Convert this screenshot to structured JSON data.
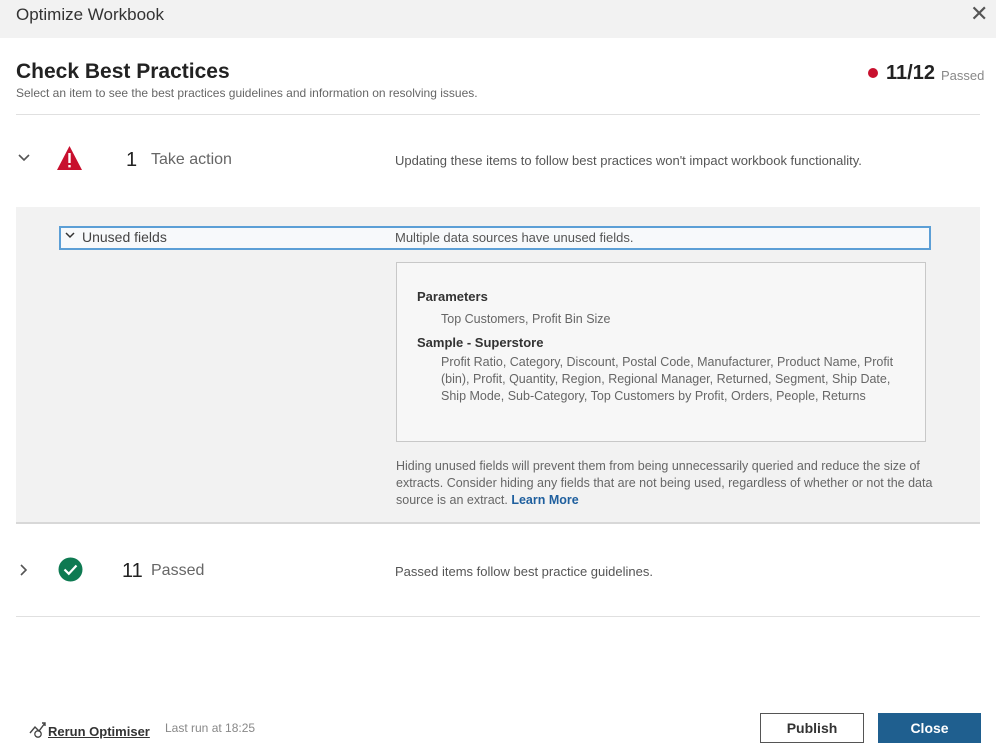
{
  "window": {
    "title": "Optimize Workbook"
  },
  "header": {
    "title": "Check Best Practices",
    "subtitle": "Select an item to see the best practices guidelines and information on resolving issues.",
    "score": "11/12",
    "score_label": "Passed",
    "status_color": "#c8102e"
  },
  "take_action": {
    "count": "1",
    "label": "Take action",
    "description": "Updating these items to follow best practices won't impact workbook functionality.",
    "item": {
      "label": "Unused fields",
      "description": "Multiple data sources have unused fields.",
      "groups": [
        {
          "title": "Parameters",
          "fields": "Top Customers, Profit Bin Size"
        },
        {
          "title": "Sample - Superstore",
          "fields": "Profit Ratio, Category, Discount, Postal Code, Manufacturer, Product Name, Profit (bin), Profit, Quantity, Region, Regional Manager, Returned, Segment, Ship Date, Ship Mode, Sub-Category, Top Customers by Profit, Orders, People, Returns"
        }
      ],
      "explanation": "Hiding unused fields will prevent them from being unnecessarily queried and reduce the size of extracts. Consider hiding any fields that are not being used, regardless of whether or not the data source is an extract.",
      "learn_more": "Learn More"
    }
  },
  "passed": {
    "count": "11",
    "label": "Passed",
    "description": "Passed items follow best practice guidelines."
  },
  "footer": {
    "rerun_label": "Rerun Optimiser",
    "last_run": "Last run at 18:25",
    "publish_label": "Publish",
    "close_label": "Close"
  },
  "colors": {
    "warning": "#c8102e",
    "success": "#0e7a52",
    "accent": "#1f5f8f",
    "selection": "#5c9fd6"
  },
  "icons": {
    "close": "close-icon",
    "warning": "warning-triangle-icon",
    "passed": "check-circle-icon",
    "expand": "chevron-down-icon",
    "collapse": "chevron-right-icon",
    "rerun": "rerun-icon"
  }
}
